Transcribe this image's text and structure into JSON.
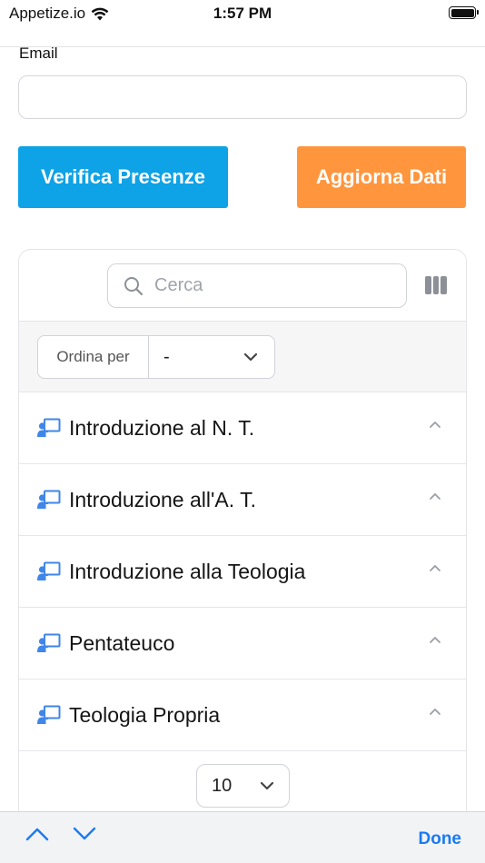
{
  "status_bar": {
    "carrier": "Appetize.io",
    "time": "1:57 PM"
  },
  "form": {
    "email_label": "Email",
    "email_value": "",
    "verifica_label": "Verifica Presenze",
    "aggiorna_label": "Aggiorna Dati"
  },
  "table": {
    "search_placeholder": "Cerca",
    "sort_label": "Ordina per",
    "sort_value": "-",
    "items": [
      {
        "title": "Introduzione al N. T."
      },
      {
        "title": "Introduzione all'A. T."
      },
      {
        "title": "Introduzione alla Teologia"
      },
      {
        "title": "Pentateuco"
      },
      {
        "title": "Teologia Propria"
      }
    ],
    "page_size": "10"
  },
  "toolbar": {
    "done_label": "Done"
  },
  "colors": {
    "primary_blue": "#0ea2e6",
    "orange": "#ff963d",
    "icon_blue": "#3f86e8",
    "link_blue": "#1a7bf2"
  },
  "icons": {
    "wifi": "wifi-icon",
    "battery": "battery-icon",
    "search": "search-icon",
    "columns": "columns-icon",
    "chevron_down": "chevron-down-icon",
    "chevron_up": "chevron-up-icon",
    "course": "chalkboard-teacher-icon"
  }
}
